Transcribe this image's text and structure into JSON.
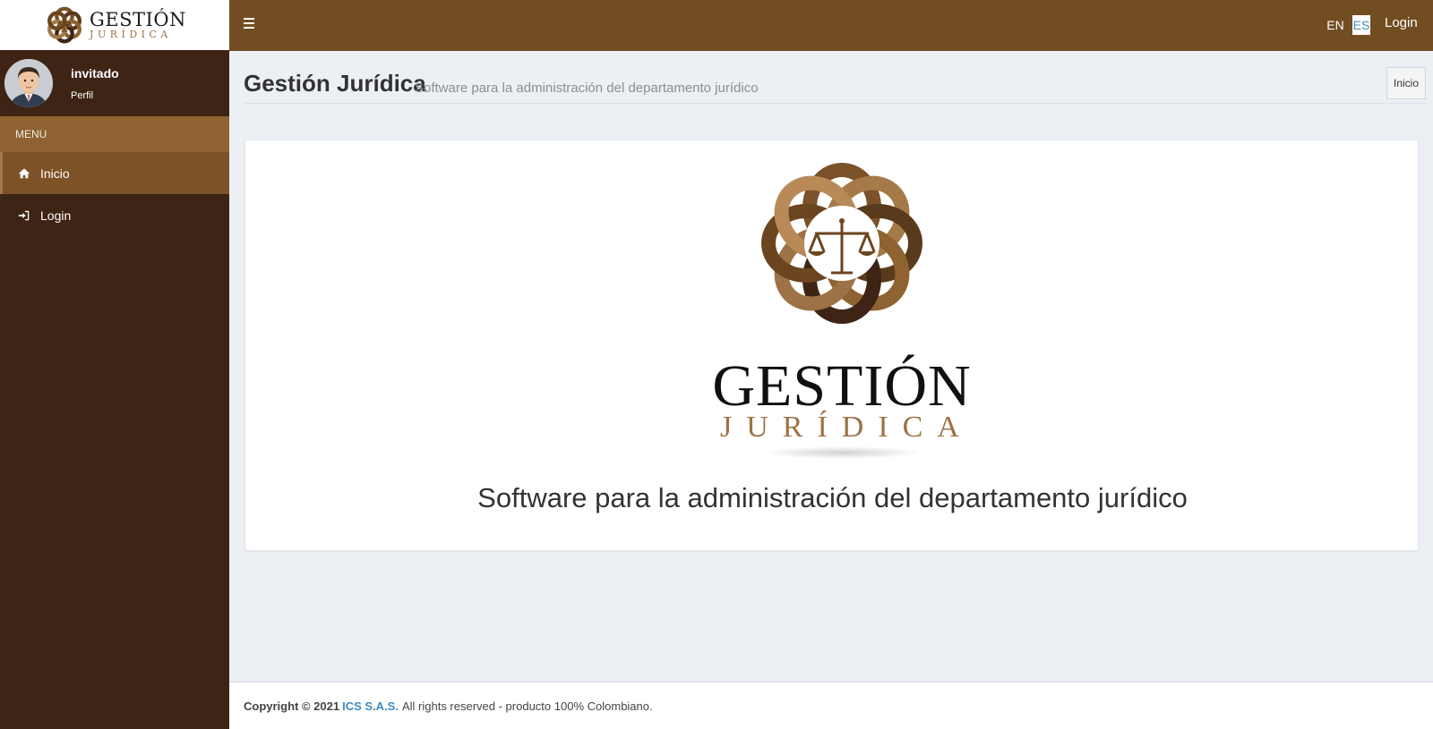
{
  "brand": {
    "logo_line1": "GESTIÓN",
    "logo_line2": "JURÍDICA",
    "primary_color": "#734d22",
    "sidebar_color": "#3d2414",
    "accent_color": "#9c7246"
  },
  "user": {
    "name": "invitado",
    "profile_link": "Perfil"
  },
  "sidebar": {
    "header": "MENU",
    "items": [
      {
        "label": "Inicio",
        "icon": "home-icon",
        "active": true
      },
      {
        "label": "Login",
        "icon": "sign-in-icon",
        "active": false
      }
    ]
  },
  "topbar": {
    "lang_en": "EN",
    "lang_es": "ES",
    "active_lang": "ES",
    "login": "Login"
  },
  "content_header": {
    "title": "Gestión Jurídica",
    "subtitle": "Software para la administración del departamento jurídico",
    "breadcrumb": "Inicio"
  },
  "main": {
    "tagline": "Software para la administración del departamento jurídico"
  },
  "footer": {
    "copyright": "Copyright © 2021",
    "company": "ICS S.A.S.",
    "rights": "All rights reserved - producto 100% Colombiano."
  }
}
